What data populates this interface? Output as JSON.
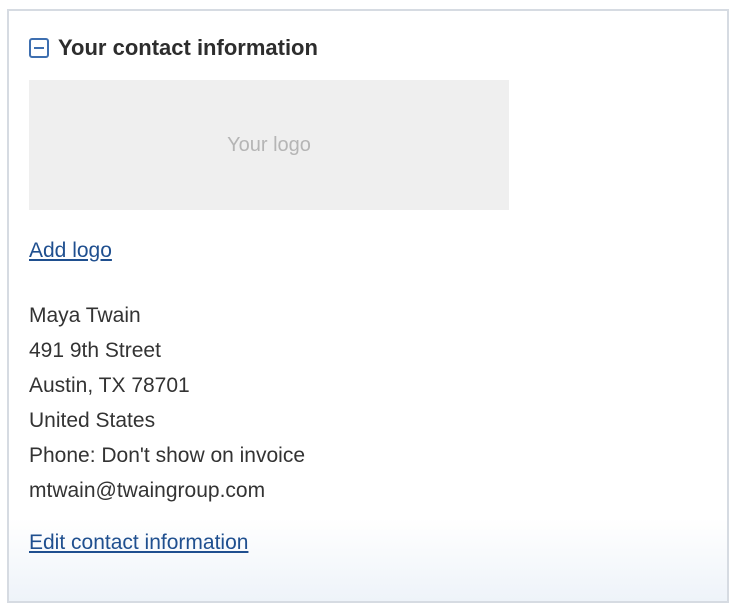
{
  "header": {
    "title": "Your contact information",
    "collapse_icon": "minus-square-icon"
  },
  "logo": {
    "placeholder": "Your logo"
  },
  "links": {
    "add_logo": "Add logo",
    "edit_contact": "Edit contact information"
  },
  "contact": {
    "lines": [
      "Maya Twain",
      "491 9th Street",
      "Austin, TX 78701",
      "United States",
      "Phone: Don't show on invoice",
      "mtwain@twaingroup.com"
    ]
  },
  "colors": {
    "link": "#1f4f8f",
    "accent": "#3e6fb0"
  }
}
